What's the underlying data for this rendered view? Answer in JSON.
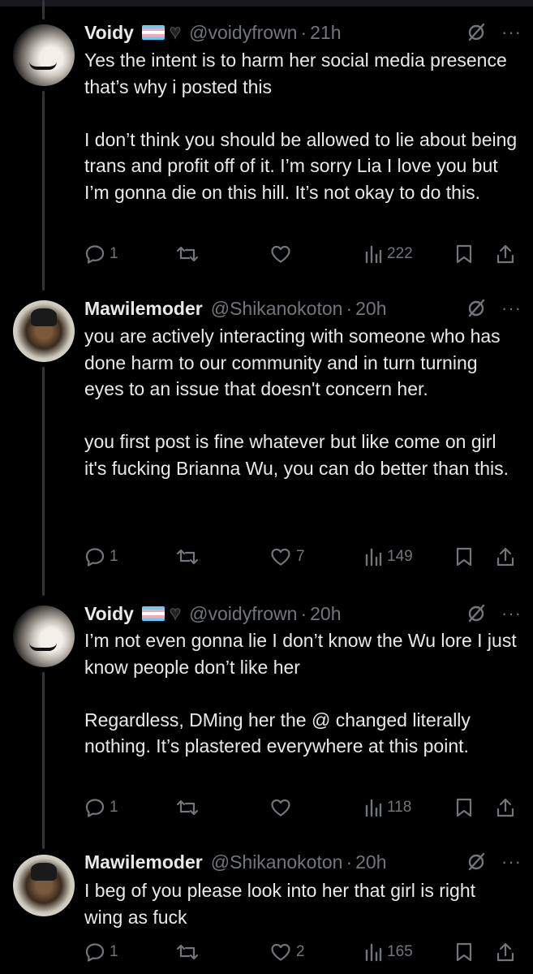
{
  "tweets": [
    {
      "name": "Voidy",
      "handle": "@voidyfrown",
      "time": "21h",
      "flag": true,
      "paragraphs": [
        "Yes the intent is to harm her social media presence that’s why i posted this",
        "I don’t think you should be allowed to lie about being trans and profit off of it. I’m sorry Lia I love you but I’m gonna die on this hill. It’s not okay to do this."
      ],
      "replies": "1",
      "retweets": "",
      "likes": "",
      "views": "222"
    },
    {
      "name": "Mawilemoder",
      "handle": "@Shikanokoton",
      "time": "20h",
      "flag": false,
      "paragraphs": [
        "you are actively interacting with someone who has done harm to our community and in turn turning eyes to an issue that doesn't concern her.",
        "you first post is fine whatever but like come on girl it's fucking Brianna Wu, you can do better than this."
      ],
      "replies": "1",
      "retweets": "",
      "likes": "7",
      "views": "149"
    },
    {
      "name": "Voidy",
      "handle": "@voidyfrown",
      "time": "20h",
      "flag": true,
      "paragraphs": [
        "I’m not even gonna lie I don’t know the Wu lore I just know people don’t like her",
        "Regardless, DMing her the @ changed literally nothing. It’s plastered everywhere at this point."
      ],
      "replies": "1",
      "retweets": "",
      "likes": "",
      "views": "118"
    },
    {
      "name": "Mawilemoder",
      "handle": "@Shikanokoton",
      "time": "20h",
      "flag": false,
      "paragraphs": [
        "I beg of you please look into her that girl is right wing as fuck"
      ],
      "replies": "1",
      "retweets": "",
      "likes": "2",
      "views": "165"
    }
  ],
  "separator": "·",
  "more_glyph": "···",
  "colors": {
    "background": "#000000",
    "text": "#e7e9ea",
    "muted": "#71767b",
    "thread_line": "#333639"
  },
  "icons": [
    "reply-icon",
    "retweet-icon",
    "like-icon",
    "views-icon",
    "bookmark-icon",
    "share-icon",
    "grok-icon",
    "more-icon",
    "trans-flag-icon",
    "black-heart-icon"
  ]
}
